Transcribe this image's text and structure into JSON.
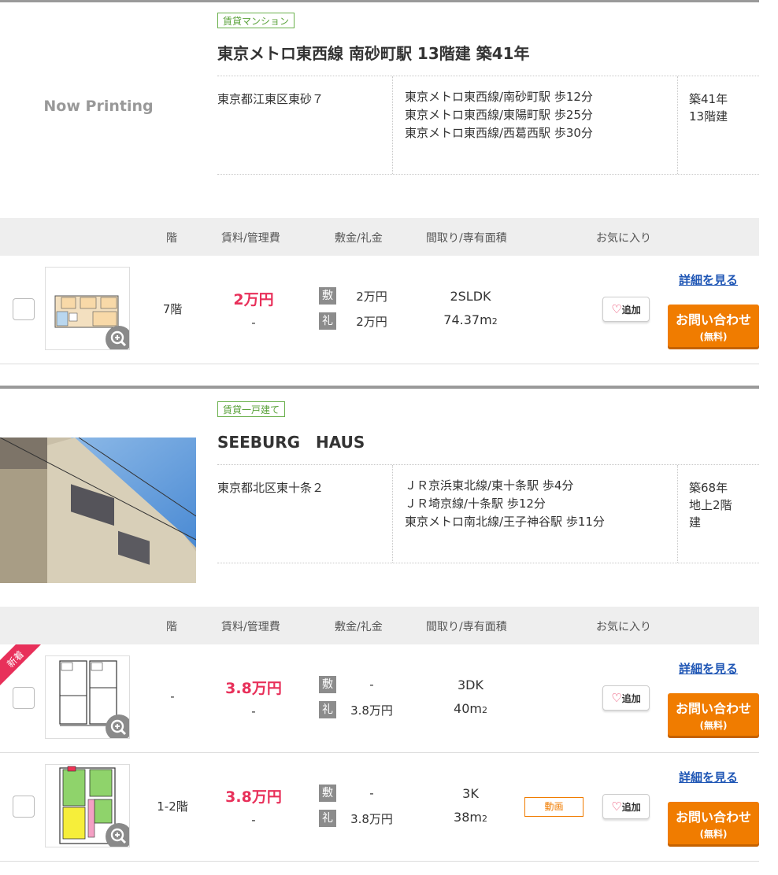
{
  "properties": [
    {
      "type_tag": "賃貸マンション",
      "title": "東京メトロ東西線 南砂町駅 13階建 築41年",
      "no_image_text": "Now Printing",
      "address": "東京都江東区東砂７",
      "stations": [
        "東京メトロ東西線/南砂町駅 歩12分",
        "東京メトロ東西線/東陽町駅 歩25分",
        "東京メトロ東西線/西葛西駅 歩30分"
      ],
      "age_lines": [
        "築41年",
        "13階建"
      ],
      "columns": {
        "floor": "階",
        "rent": "賃料/管理費",
        "deposit": "敷金/礼金",
        "layout": "間取り/専有面積",
        "fav": "お気に入り"
      },
      "units": [
        {
          "floor": "7階",
          "rent": "2万円",
          "mgmt": "-",
          "deposit_key": "敷",
          "deposit": "2万円",
          "key_money_key": "礼",
          "key_money": "2万円",
          "layout": "2SLDK",
          "area": "74.37m",
          "area_unit": "2",
          "fav_label": "追加",
          "detail_label": "詳細を見る",
          "contact_label": "お問い合わせ",
          "contact_sub": "(無料)"
        }
      ]
    },
    {
      "type_tag": "賃貸一戸建て",
      "title": "SEEBURG　HAUS",
      "address": "東京都北区東十条２",
      "stations": [
        "ＪＲ京浜東北線/東十条駅 歩4分",
        "ＪＲ埼京線/十条駅 歩12分",
        "東京メトロ南北線/王子神谷駅 歩11分"
      ],
      "age_lines": [
        "築68年",
        "地上2階",
        "建"
      ],
      "columns": {
        "floor": "階",
        "rent": "賃料/管理費",
        "deposit": "敷金/礼金",
        "layout": "間取り/専有面積",
        "fav": "お気に入り"
      },
      "units": [
        {
          "new_badge": "新着",
          "floor": "-",
          "rent": "3.8万円",
          "mgmt": "-",
          "deposit_key": "敷",
          "deposit": "-",
          "key_money_key": "礼",
          "key_money": "3.8万円",
          "layout": "3DK",
          "area": "40m",
          "area_unit": "2",
          "fav_label": "追加",
          "detail_label": "詳細を見る",
          "contact_label": "お問い合わせ",
          "contact_sub": "(無料)"
        },
        {
          "floor": "1-2階",
          "rent": "3.8万円",
          "mgmt": "-",
          "deposit_key": "敷",
          "deposit": "-",
          "key_money_key": "礼",
          "key_money": "3.8万円",
          "layout": "3K",
          "area": "38m",
          "area_unit": "2",
          "movie_label": "動画",
          "fav_label": "追加",
          "detail_label": "詳細を見る",
          "contact_label": "お問い合わせ",
          "contact_sub": "(無料)"
        }
      ]
    }
  ],
  "colors": {
    "price": "#e8305a",
    "contact": "#f07c00",
    "tag": "#6ab04c",
    "link": "#1f56b5"
  },
  "icons": {
    "zoom": "zoom-in-icon",
    "heart": "heart-icon"
  }
}
